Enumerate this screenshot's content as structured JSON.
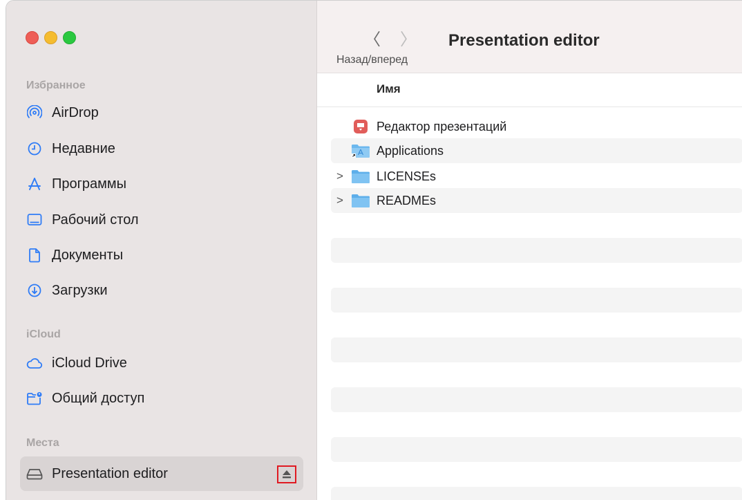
{
  "sidebar": {
    "favorites_label": "Избранное",
    "favorites": [
      {
        "label": "AirDrop",
        "icon": "airdrop-icon"
      },
      {
        "label": "Недавние",
        "icon": "clock-icon"
      },
      {
        "label": "Программы",
        "icon": "applications-icon"
      },
      {
        "label": "Рабочий стол",
        "icon": "desktop-icon"
      },
      {
        "label": "Документы",
        "icon": "document-icon"
      },
      {
        "label": "Загрузки",
        "icon": "downloads-icon"
      }
    ],
    "icloud_label": "iCloud",
    "icloud": [
      {
        "label": "iCloud Drive",
        "icon": "cloud-icon"
      },
      {
        "label": "Общий доступ",
        "icon": "shared-folder-icon"
      }
    ],
    "places_label": "Места",
    "places": [
      {
        "label": "Presentation editor",
        "icon": "drive-icon",
        "selected": true
      }
    ]
  },
  "toolbar": {
    "title": "Presentation editor",
    "back_glyph": "〈",
    "forward_glyph": "〉",
    "nav_label": "Назад/вперед"
  },
  "list": {
    "column_name": "Имя",
    "rows": [
      {
        "name": "Редактор презентаций",
        "icon": "presentation-app-icon",
        "expandable": false
      },
      {
        "name": "Applications",
        "icon": "applications-alias-folder-icon",
        "expandable": false
      },
      {
        "name": "LICENSEs",
        "icon": "folder-icon",
        "expandable": true
      },
      {
        "name": "READMEs",
        "icon": "folder-icon",
        "expandable": true
      }
    ]
  },
  "colors": {
    "accent": "#2f7cf6",
    "eject_highlight": "#e01a22",
    "folder": "#6cb8ee"
  }
}
